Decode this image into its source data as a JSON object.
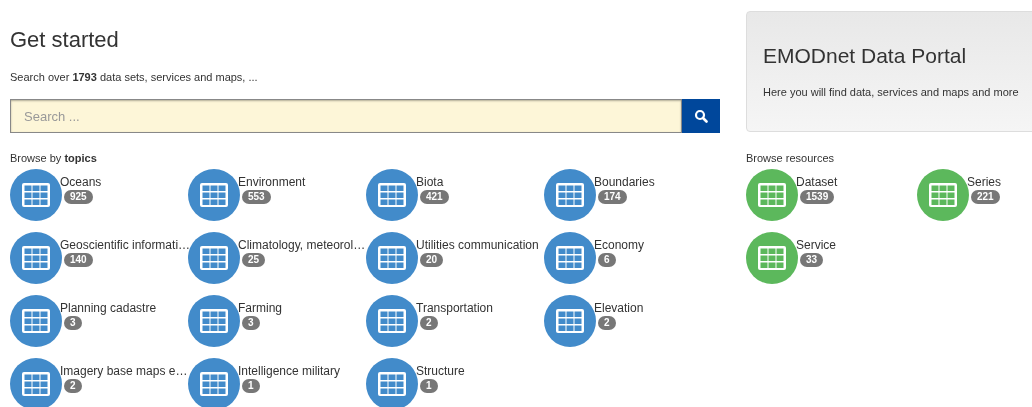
{
  "heading": "Get started",
  "intro": "Search over **1793** data sets, services and maps, ...",
  "search": {
    "placeholder": "Search ..."
  },
  "topics_title": "Browse by **topics**",
  "topics": [
    {
      "label": "Oceans",
      "count": "925"
    },
    {
      "label": "Environment",
      "count": "553"
    },
    {
      "label": "Biota",
      "count": "421"
    },
    {
      "label": "Boundaries",
      "count": "174"
    },
    {
      "label": "Geoscientific informati…",
      "count": "140"
    },
    {
      "label": "Climatology, meteorol…",
      "count": "25"
    },
    {
      "label": "Utilities communication",
      "count": "20"
    },
    {
      "label": "Economy",
      "count": "6"
    },
    {
      "label": "Planning cadastre",
      "count": "3"
    },
    {
      "label": "Farming",
      "count": "3"
    },
    {
      "label": "Transportation",
      "count": "2"
    },
    {
      "label": "Elevation",
      "count": "2"
    },
    {
      "label": "Imagery base maps e…",
      "count": "2"
    },
    {
      "label": "Intelligence military",
      "count": "1"
    },
    {
      "label": "Structure",
      "count": "1"
    }
  ],
  "portal": {
    "title": "EMODnet Data Portal",
    "text": "Here you will find data, services and maps and more"
  },
  "resources_title": "Browse resources",
  "resources": [
    {
      "label": "Dataset",
      "count": "1539"
    },
    {
      "label": "Series",
      "count": "221"
    },
    {
      "label": "Service",
      "count": "33"
    }
  ]
}
